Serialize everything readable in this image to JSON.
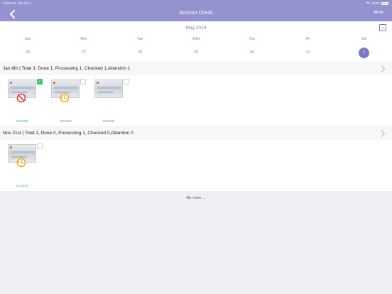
{
  "status_bar": {
    "time": "11:03 AM",
    "date": "Sat Jun 1",
    "battery": "100%"
  },
  "nav": {
    "title": "Account Check",
    "more_label": "More"
  },
  "calendar": {
    "month": "May 2019",
    "today_icon_label": "1",
    "weekdays": [
      "Sun",
      "Mon",
      "Tue",
      "Wed",
      "Thu",
      "Fri",
      "Sat"
    ],
    "days": [
      "26",
      "27",
      "28",
      "29",
      "30",
      "31",
      "1"
    ],
    "selected_day": "1"
  },
  "groups": [
    {
      "title": "Jan 8th | Total 3, Done 1, Processing 1, Checked 1,Abandon 1",
      "items": [
        {
          "id": "1801080",
          "status": "abandoned",
          "status_icon": "prohibited-icon",
          "checked": true
        },
        {
          "id": "1801080",
          "status": "processing",
          "status_icon": "history-clock-icon",
          "checked": false
        },
        {
          "id": "1801081",
          "status": "done",
          "status_icon": "",
          "checked": false
        }
      ]
    },
    {
      "title": "Nov 21st | Total 1, Done 0, Processing 1, Checked 0,Abandon 0",
      "items": [
        {
          "id": "1711211",
          "status": "processing",
          "status_icon": "history-clock-icon",
          "checked": false
        }
      ]
    }
  ],
  "footer": {
    "no_more": "No more ..."
  },
  "colors": {
    "header": "#9593cf",
    "accent": "#7b79c4",
    "checked": "#3cc46a",
    "abandon": "#e53935",
    "processing": "#f0a500",
    "link": "#4aa0d8"
  }
}
